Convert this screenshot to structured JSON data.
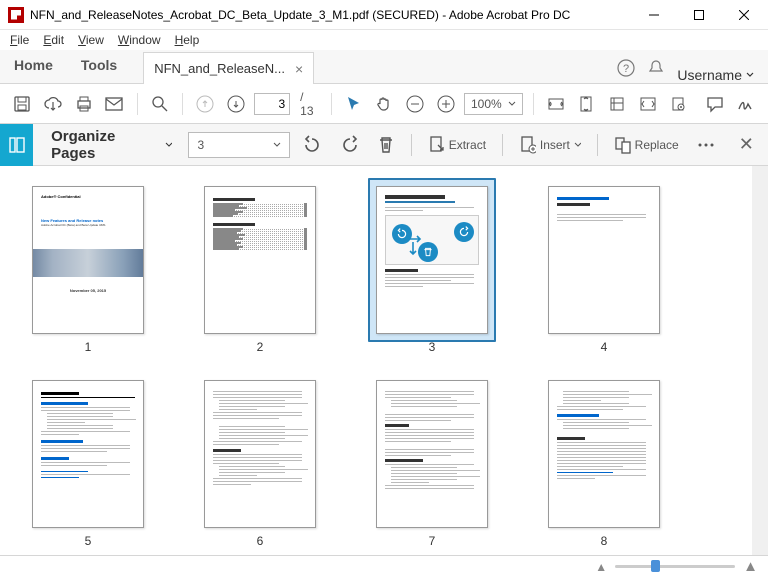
{
  "titlebar": {
    "title": "NFN_and_ReleaseNotes_Acrobat_DC_Beta_Update_3_M1.pdf (SECURED) - Adobe Acrobat Pro DC"
  },
  "menu": {
    "file": "File",
    "edit": "Edit",
    "view": "View",
    "window": "Window",
    "help": "Help"
  },
  "tabs": {
    "home": "Home",
    "tools": "Tools",
    "doc": "NFN_and_ReleaseN...",
    "user": "Username"
  },
  "toolbar": {
    "page": "3",
    "total": "/  13",
    "zoom": "100%"
  },
  "org": {
    "title": "Organize Pages",
    "page_dd": "3",
    "extract": "Extract",
    "insert": "Insert",
    "replace": "Replace"
  },
  "thumbs": {
    "p1": "1",
    "p2": "2",
    "p3": "3",
    "p4": "4",
    "p5": "5",
    "p6": "6",
    "p7": "7",
    "p8": "8"
  }
}
